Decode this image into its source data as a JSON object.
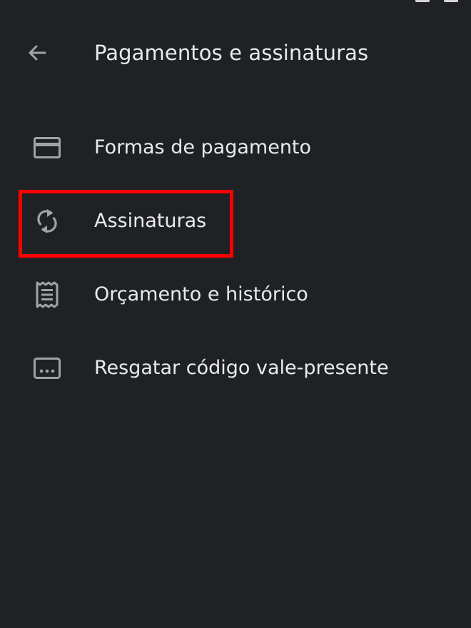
{
  "header": {
    "title": "Pagamentos e assinaturas",
    "back_icon": "arrow-left-icon"
  },
  "menu": {
    "items": [
      {
        "label": "Formas de pagamento",
        "icon": "credit-card-icon"
      },
      {
        "label": "Assinaturas",
        "icon": "sync-icon"
      },
      {
        "label": "Orçamento e histórico",
        "icon": "receipt-icon"
      },
      {
        "label": "Resgatar código vale-presente",
        "icon": "gift-card-code-icon"
      }
    ]
  },
  "colors": {
    "background": "#202124",
    "text": "#e8eaed",
    "icon": "#a0a3a6",
    "highlight": "#ff0000"
  },
  "annotation": {
    "highlighted_item": "Assinaturas"
  }
}
